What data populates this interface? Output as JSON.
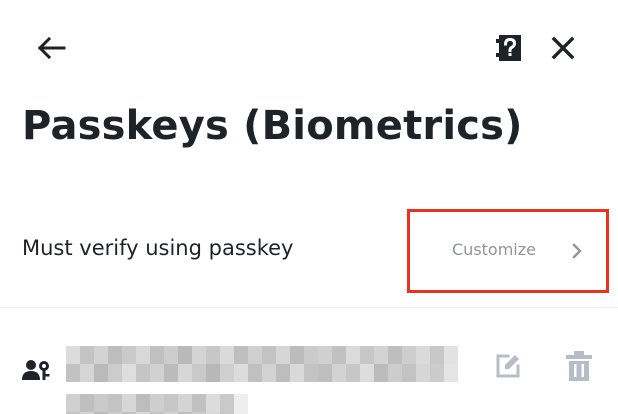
{
  "header": {
    "back_icon": "arrow-left-icon",
    "help_icon": "help-document-icon",
    "close_icon": "close-icon"
  },
  "page": {
    "title": "Passkeys (Biometrics)"
  },
  "verification": {
    "label": "Must verify using passkey",
    "customize_label": "Customize",
    "chevron_icon": "chevron-right-icon"
  },
  "passkey": {
    "user_icon": "user-key-icon",
    "edit_icon": "edit-icon",
    "delete_icon": "trash-icon"
  },
  "colors": {
    "text_primary": "#1e2329",
    "text_secondary": "#8f959d",
    "icon_disabled": "#b7bdc6",
    "highlight": "#e8331f",
    "divider": "#eaecef",
    "background": "#ffffff"
  }
}
